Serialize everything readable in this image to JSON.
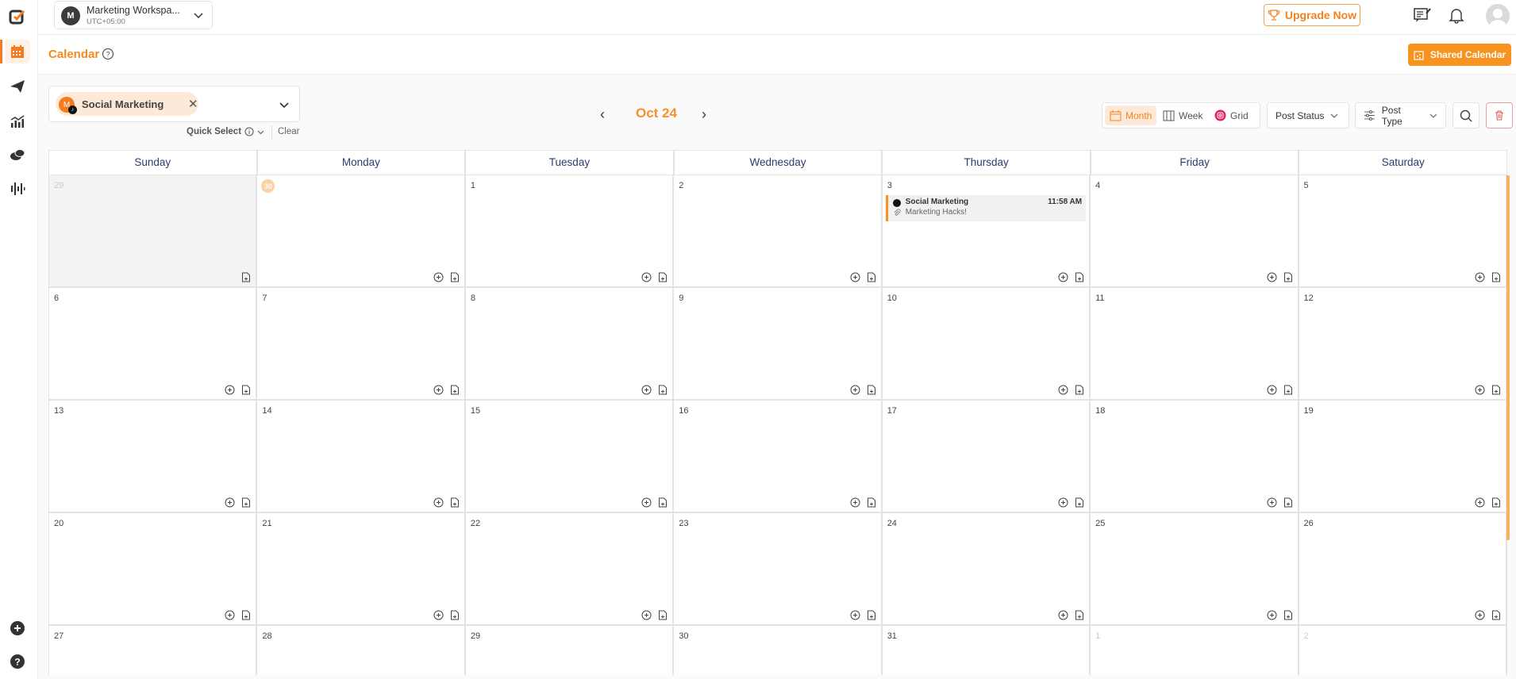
{
  "workspace": {
    "initial": "M",
    "name": "Marketing Workspa...",
    "timezone": "UTC+05:00"
  },
  "topbar": {
    "upgrade_label": "Upgrade Now"
  },
  "page": {
    "title": "Calendar",
    "shared_calendar_label": "Shared Calendar"
  },
  "filter": {
    "chip": {
      "initial": "M",
      "label": "Social Marketing",
      "network": "tiktok"
    },
    "quick_select_label": "Quick Select",
    "clear_label": "Clear"
  },
  "nav": {
    "current_month": "Oct 24"
  },
  "views": [
    {
      "label": "Month",
      "active": true
    },
    {
      "label": "Week",
      "active": false
    },
    {
      "label": "Grid",
      "active": false
    }
  ],
  "dropdowns": {
    "post_status": "Post Status",
    "post_type": "Post Type"
  },
  "colors": {
    "accent": "#f7931e",
    "title": "#f58a1f",
    "day_header": "#2d3a6e"
  },
  "calendar": {
    "weekdays": [
      "Sunday",
      "Monday",
      "Tuesday",
      "Wednesday",
      "Thursday",
      "Friday",
      "Saturday"
    ],
    "weeks": [
      [
        {
          "d": "29",
          "type": "past"
        },
        {
          "d": "30",
          "type": "today"
        },
        {
          "d": "1"
        },
        {
          "d": "2"
        },
        {
          "d": "3",
          "event": {
            "account": "Social Marketing",
            "time": "11:58 AM",
            "caption": "Marketing Hacks!"
          }
        },
        {
          "d": "4"
        },
        {
          "d": "5"
        }
      ],
      [
        {
          "d": "6"
        },
        {
          "d": "7"
        },
        {
          "d": "8"
        },
        {
          "d": "9"
        },
        {
          "d": "10"
        },
        {
          "d": "11"
        },
        {
          "d": "12"
        }
      ],
      [
        {
          "d": "13"
        },
        {
          "d": "14"
        },
        {
          "d": "15"
        },
        {
          "d": "16"
        },
        {
          "d": "17"
        },
        {
          "d": "18"
        },
        {
          "d": "19"
        }
      ],
      [
        {
          "d": "20"
        },
        {
          "d": "21"
        },
        {
          "d": "22"
        },
        {
          "d": "23"
        },
        {
          "d": "24"
        },
        {
          "d": "25"
        },
        {
          "d": "26"
        }
      ],
      [
        {
          "d": "27"
        },
        {
          "d": "28"
        },
        {
          "d": "29"
        },
        {
          "d": "30"
        },
        {
          "d": "31"
        },
        {
          "d": "1",
          "type": "other"
        },
        {
          "d": "2",
          "type": "other"
        }
      ]
    ]
  }
}
